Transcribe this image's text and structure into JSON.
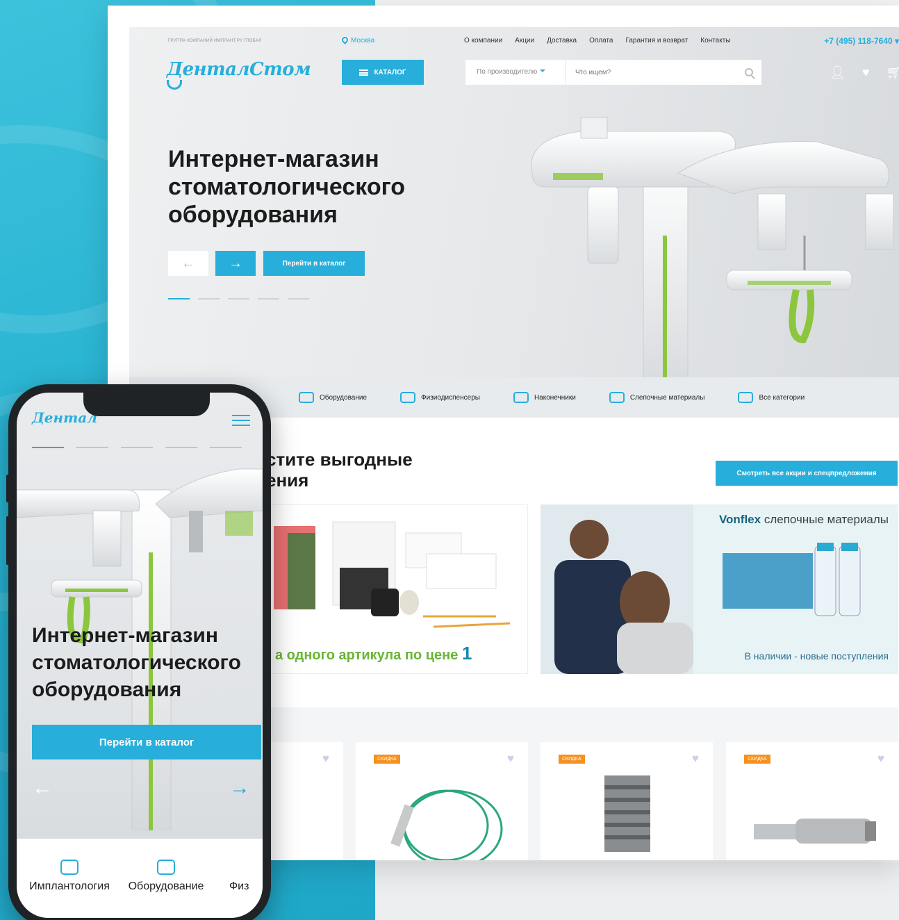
{
  "colors": {
    "accent": "#27aedb",
    "sale_badge": "#f6901e",
    "green": "#8cc63f"
  },
  "desktop": {
    "topbar": {
      "group_label": "ГРУППА КОМПАНИЙ   ИМПЛАНТ.РУ ГЛОБАЛ",
      "city": "Москва",
      "nav": [
        "О компании",
        "Акции",
        "Доставка",
        "Оплата",
        "Гарантия и возврат",
        "Контакты"
      ],
      "phone": "+7 (495) 118-7640"
    },
    "header": {
      "logo_text": "ДенталСтом",
      "catalog_label": "КАТАЛОГ",
      "search_maker": "По производителю",
      "search_placeholder": "Что ищем?",
      "icons": [
        "user-icon",
        "heart-icon",
        "cart-icon"
      ]
    },
    "hero": {
      "title": "Интернет-магазин стоматологического оборудования",
      "prev_arrow": "←",
      "next_arrow": "→",
      "cta": "Перейти в каталог"
    },
    "categories": [
      {
        "label": "Оборудование",
        "icon": "equipment-icon"
      },
      {
        "label": "Физиодиспенсеры",
        "icon": "dispenser-icon"
      },
      {
        "label": "Наконечники",
        "icon": "handpiece-icon"
      },
      {
        "label": "Слепочные материалы",
        "icon": "impression-icon"
      },
      {
        "label": "Все категории",
        "icon": "all-categories-icon"
      }
    ],
    "promo": {
      "title_line1": "стите выгодные",
      "title_line2": "ения",
      "all_offers_btn": "Смотреть все акции и спецпредложения"
    },
    "banner1": {
      "caption": "а одного артикула по цене",
      "caption_number": "1"
    },
    "banner2": {
      "brand": "Vonflex",
      "title_rest": "слепочные материалы",
      "caption": "В наличии - новые поступления"
    },
    "products": [
      {
        "badge": ""
      },
      {
        "badge": "СКИДКА"
      },
      {
        "badge": "СКИДКА"
      },
      {
        "badge": "СКИДКА"
      }
    ]
  },
  "mobile": {
    "logo_text": "Дентал",
    "hero_title": "Интернет-магазин стоматологического оборудования",
    "cta": "Перейти в каталог",
    "prev_arrow": "←",
    "next_arrow": "→",
    "categories": [
      "Имплантология",
      "Оборудование",
      "Физ"
    ]
  }
}
